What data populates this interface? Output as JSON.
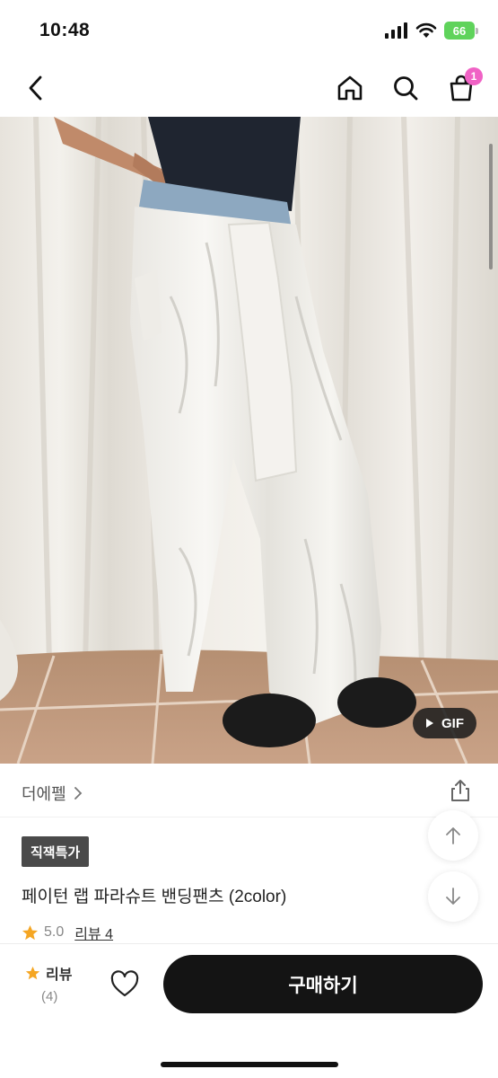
{
  "status_bar": {
    "time": "10:48",
    "battery": "66"
  },
  "nav": {
    "icons": [
      "back-icon",
      "home-icon",
      "search-icon",
      "cart-icon"
    ],
    "cart_count": "1"
  },
  "product_image": {
    "badge_label": "GIF"
  },
  "shop": {
    "name": "더에펠"
  },
  "product": {
    "tag": "직잭특가",
    "title": "페이턴 랩 파라슈트 밴딩팬츠 (2color)",
    "rating": "5.0",
    "review_link": "리뷰 4"
  },
  "bottom_bar": {
    "review_label": "리뷰",
    "review_count": "(4)",
    "buy_label": "구매하기"
  },
  "colors": {
    "accent_badge": "#f062c5",
    "battery": "#5fd35b",
    "star": "#f5a623",
    "buy_button": "#141414"
  }
}
